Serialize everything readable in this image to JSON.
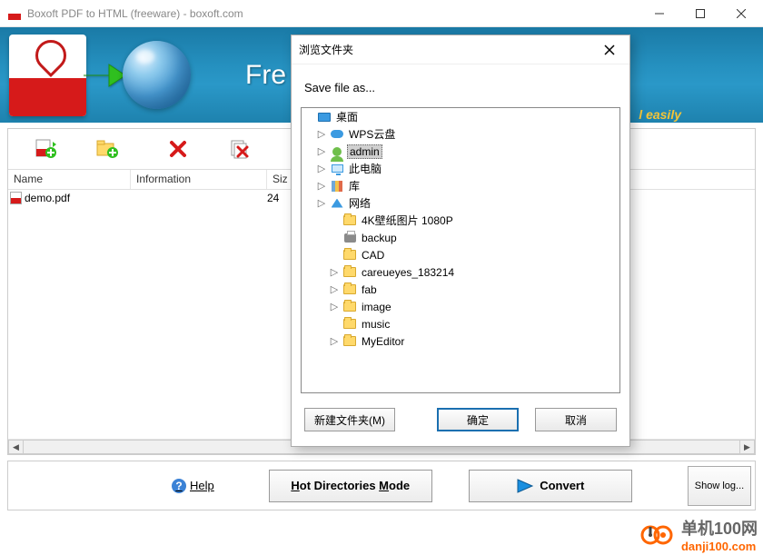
{
  "window": {
    "title": "Boxoft PDF to HTML (freeware) - boxoft.com"
  },
  "banner": {
    "title_visible": "Fre",
    "subtitle_visible": "l easily"
  },
  "toolbar": {
    "buttons": [
      {
        "name": "add-pdf",
        "label": ""
      },
      {
        "name": "add-folder",
        "label": ""
      },
      {
        "name": "remove",
        "label": ""
      },
      {
        "name": "remove-all",
        "label": ""
      }
    ]
  },
  "table": {
    "columns": {
      "name": "Name",
      "info": "Information",
      "size": "Siz"
    },
    "rows": [
      {
        "name": "demo.pdf",
        "info": "",
        "size": "24"
      }
    ]
  },
  "bottom": {
    "help": "Help",
    "mode": "Hot Directories Mode",
    "convert": "Convert",
    "showlog": "Show log..."
  },
  "dialog": {
    "title": "浏览文件夹",
    "prompt": "Save file as...",
    "tree": [
      {
        "depth": 0,
        "icon": "desktop",
        "expander": "",
        "label": "桌面",
        "selected": false
      },
      {
        "depth": 1,
        "icon": "cloud",
        "expander": "▷",
        "label": "WPS云盘",
        "selected": false
      },
      {
        "depth": 1,
        "icon": "user",
        "expander": "▷",
        "label": "admin",
        "selected": true
      },
      {
        "depth": 1,
        "icon": "monitor",
        "expander": "▷",
        "label": "此电脑",
        "selected": false
      },
      {
        "depth": 1,
        "icon": "lib",
        "expander": "▷",
        "label": "库",
        "selected": false
      },
      {
        "depth": 1,
        "icon": "net",
        "expander": "▷",
        "label": "网络",
        "selected": false
      },
      {
        "depth": 2,
        "icon": "folder",
        "expander": "",
        "label": "4K壁纸图片 1080P",
        "selected": false
      },
      {
        "depth": 2,
        "icon": "printer",
        "expander": "",
        "label": "backup",
        "selected": false
      },
      {
        "depth": 2,
        "icon": "folder",
        "expander": "",
        "label": "CAD",
        "selected": false
      },
      {
        "depth": 2,
        "icon": "folder",
        "expander": "▷",
        "label": "careueyes_183214",
        "selected": false
      },
      {
        "depth": 2,
        "icon": "folder",
        "expander": "▷",
        "label": "fab",
        "selected": false
      },
      {
        "depth": 2,
        "icon": "folder",
        "expander": "▷",
        "label": "image",
        "selected": false
      },
      {
        "depth": 2,
        "icon": "folder",
        "expander": "",
        "label": "music",
        "selected": false
      },
      {
        "depth": 2,
        "icon": "folder",
        "expander": "▷",
        "label": "MyEditor",
        "selected": false
      }
    ],
    "buttons": {
      "new_folder": "新建文件夹(M)",
      "ok": "确定",
      "cancel": "取消"
    }
  },
  "watermark": {
    "text_cn": "单机100网",
    "text_url": "danji100.com"
  }
}
